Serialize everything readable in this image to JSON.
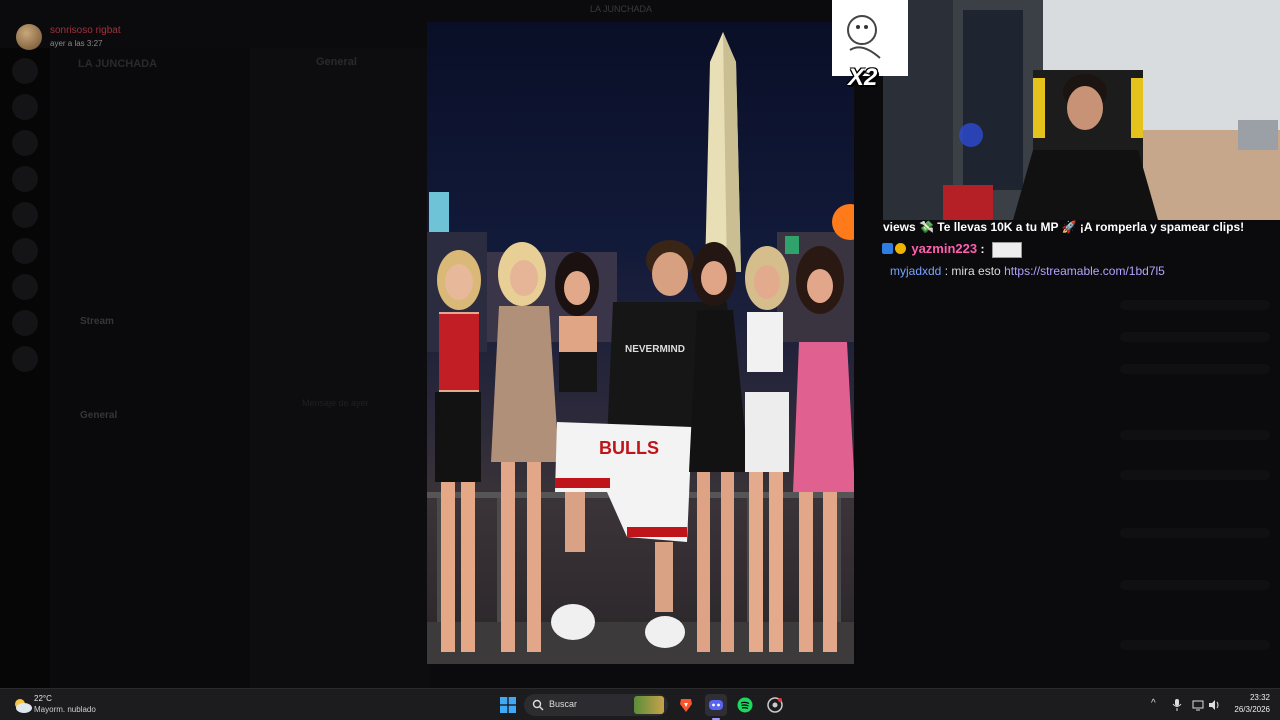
{
  "window": {
    "title": "LA JUNCHADA"
  },
  "notification": {
    "user": "sonrisoso rigbat",
    "time": "ayer a las 3:27"
  },
  "discord_bg": {
    "guild": "LA JUNCHADA",
    "channel_title": "General",
    "channels": [
      "Stream",
      "General"
    ],
    "message": "Mensaje de ayer",
    "username": "sonrisoso"
  },
  "overlay": {
    "emote_multiplier": "X2",
    "chat": [
      {
        "text": "views 💸 Te llevas 10K a tu MP 🚀 ¡A romperla y spamear clips!"
      },
      {
        "user": "yazmin223",
        "sep": " :"
      },
      {
        "user": "myjadxdd",
        "sep": " : ",
        "text": "mira esto",
        "link": "https://streamable.com/1bd7l5"
      }
    ]
  },
  "photo": {
    "shirt_text": "NEVERMIND",
    "shorts_text": "BULLS"
  },
  "taskbar": {
    "weather_temp": "22°C",
    "weather_desc": "Mayorm. nublado",
    "search_placeholder": "Buscar",
    "time": "23:32",
    "date": "26/3/2026",
    "colors": {
      "bg": "#1c1c1f",
      "accent": "#9b9bff"
    },
    "icons": [
      "windows-start-icon",
      "search-icon",
      "brave-browser-icon",
      "discord-icon",
      "spotify-icon",
      "chrome-icon"
    ]
  }
}
